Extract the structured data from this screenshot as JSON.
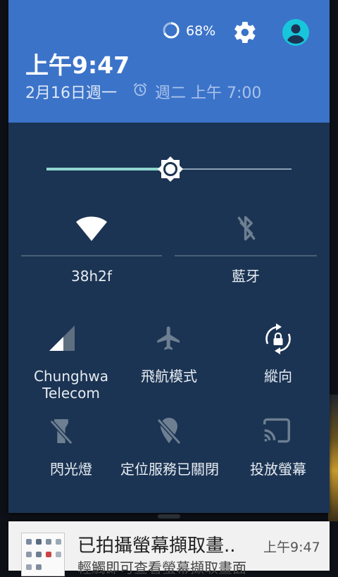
{
  "status": {
    "battery_percent_text": "68%",
    "battery_level": 0.68,
    "settings_icon": "gear-icon",
    "user_icon": "account-circle-icon"
  },
  "header": {
    "time": "上午9:47",
    "date": "2月16日週一",
    "alarm_icon": "alarm-clock-icon",
    "next_alarm": "週二 上午 7:00"
  },
  "brightness": {
    "level": 0.5,
    "icon": "brightness-icon"
  },
  "tiles": {
    "wifi": {
      "label": "38h2f",
      "icon": "wifi-icon",
      "active": true
    },
    "bluetooth": {
      "label": "藍牙",
      "icon": "bluetooth-off-icon",
      "active": false
    },
    "cellular": {
      "label_line1": "Chunghwa",
      "label_line2": "Telecom",
      "icon": "cellular-signal-icon"
    },
    "airplane": {
      "label": "飛航模式",
      "icon": "airplane-icon",
      "active": false
    },
    "rotation": {
      "label": "縱向",
      "icon": "rotation-lock-icon",
      "active": true
    },
    "flashlight": {
      "label": "閃光燈",
      "icon": "flashlight-off-icon",
      "active": false
    },
    "location": {
      "label": "定位服務已關閉",
      "icon": "location-off-icon",
      "active": false
    },
    "cast": {
      "label": "投放螢幕",
      "icon": "cast-icon",
      "active": false
    }
  },
  "notification": {
    "title": "已拍攝螢幕擷取畫..",
    "time": "上午9:47",
    "subtitle": "輕觸即可查看螢幕擷取畫面"
  },
  "colors": {
    "header_bg": "#3b73c9",
    "panel_bg": "#1c3453",
    "accent": "#8fd6cf",
    "avatar": "#18c6dc"
  }
}
